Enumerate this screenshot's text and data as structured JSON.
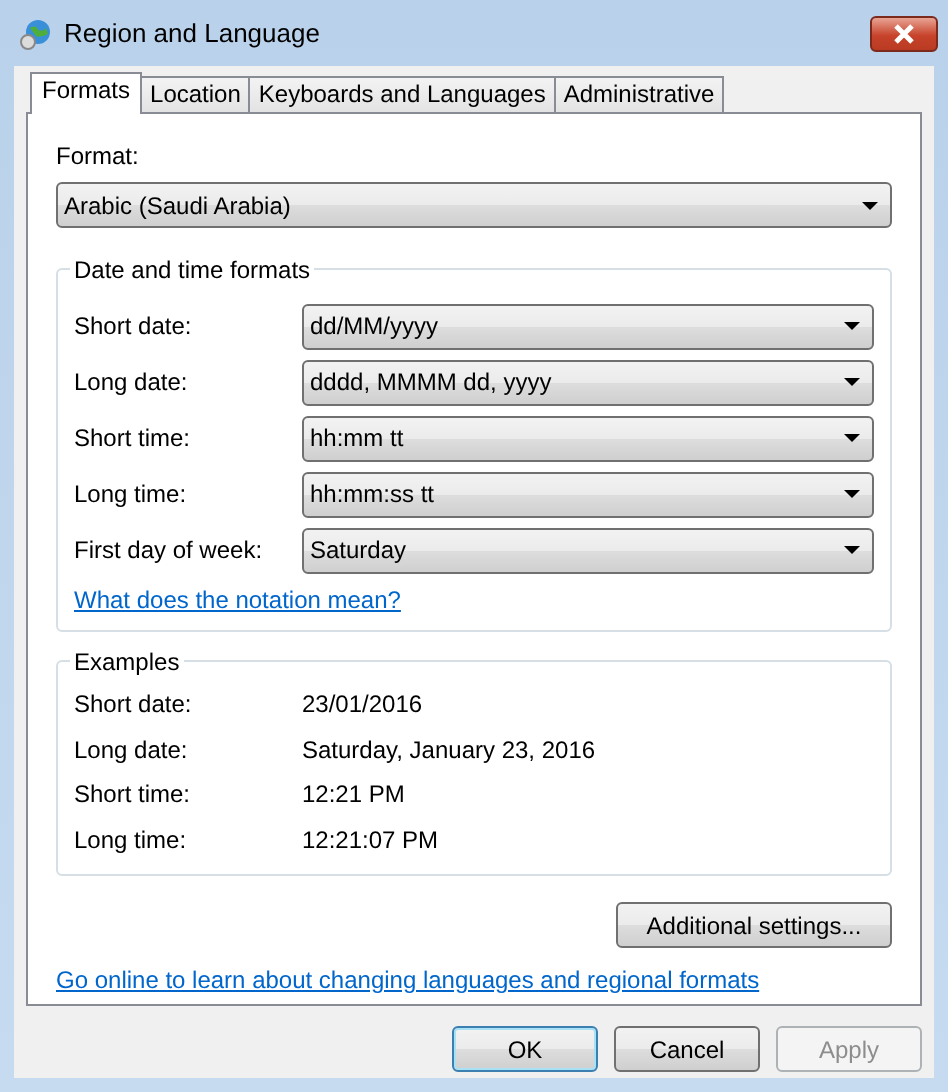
{
  "window": {
    "title": "Region and Language"
  },
  "tabs": [
    {
      "label": "Formats",
      "selected": true
    },
    {
      "label": "Location",
      "selected": false
    },
    {
      "label": "Keyboards and Languages",
      "selected": false
    },
    {
      "label": "Administrative",
      "selected": false
    }
  ],
  "format": {
    "label": "Format:",
    "value": "Arabic (Saudi Arabia)"
  },
  "date_time_formats": {
    "title": "Date and time formats",
    "rows": [
      {
        "label": "Short date:",
        "value": "dd/MM/yyyy"
      },
      {
        "label": "Long date:",
        "value": "dddd, MMMM dd, yyyy"
      },
      {
        "label": "Short time:",
        "value": "hh:mm tt"
      },
      {
        "label": "Long time:",
        "value": "hh:mm:ss tt"
      },
      {
        "label": "First day of week:",
        "value": "Saturday"
      }
    ],
    "link": "What does the notation mean?"
  },
  "examples": {
    "title": "Examples",
    "rows": [
      {
        "label": "Short date:",
        "value": "23/01/2016"
      },
      {
        "label": "Long date:",
        "value": "Saturday, January 23, 2016"
      },
      {
        "label": "Short time:",
        "value": "12:21 PM"
      },
      {
        "label": "Long time:",
        "value": "12:21:07 PM"
      }
    ]
  },
  "additional_button": "Additional settings...",
  "online_link": "Go online to learn about changing languages and regional formats",
  "buttons": [
    {
      "label": "OK",
      "default": true,
      "disabled": false
    },
    {
      "label": "Cancel",
      "default": false,
      "disabled": false
    },
    {
      "label": "Apply",
      "default": false,
      "disabled": true
    }
  ]
}
